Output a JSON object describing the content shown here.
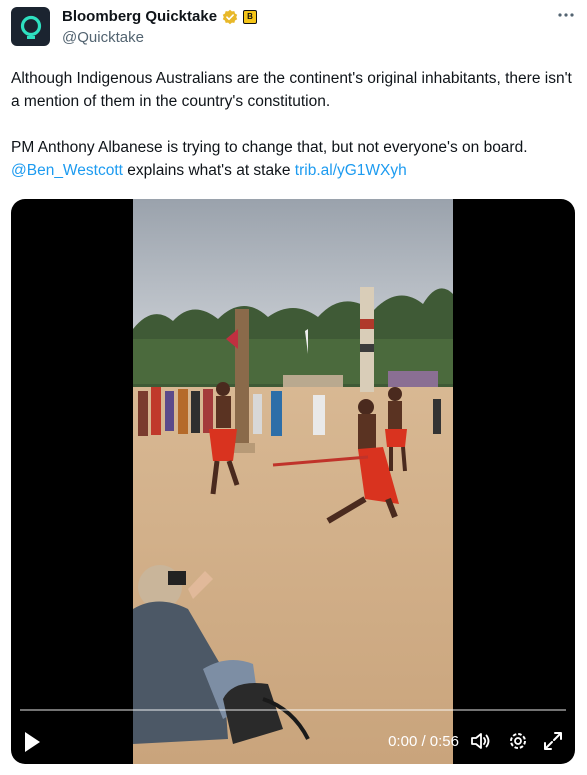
{
  "author": {
    "display_name": "Bloomberg Quicktake",
    "handle": "@Quicktake",
    "affiliate_badge": "B",
    "icons": {
      "avatar": "quicktake-logo",
      "verified": "gold-verified-badge",
      "more": "more-options-icon"
    }
  },
  "tweet": {
    "paragraph1": "Although Indigenous Australians are the continent's original inhabitants, there isn't a mention of them in the country's constitution.",
    "p2_before": "PM Anthony Albanese is trying to change that, but not everyone's on board.",
    "mention": "@Ben_Westcott",
    "p2_middle": "explains what's at stake",
    "url": "trib.al/yG1WXyh"
  },
  "video": {
    "time": "0:00 / 0:56",
    "progress": 0,
    "controls": [
      "play-icon",
      "volume-icon",
      "settings-icon",
      "fullscreen-icon"
    ]
  },
  "colors": {
    "link": "#1d9bf0",
    "text": "#0f1419",
    "secondary": "#536471",
    "verified": "#e8b829",
    "avatar_bg": "#1b2430",
    "avatar_accent": "#2ee0c0"
  }
}
